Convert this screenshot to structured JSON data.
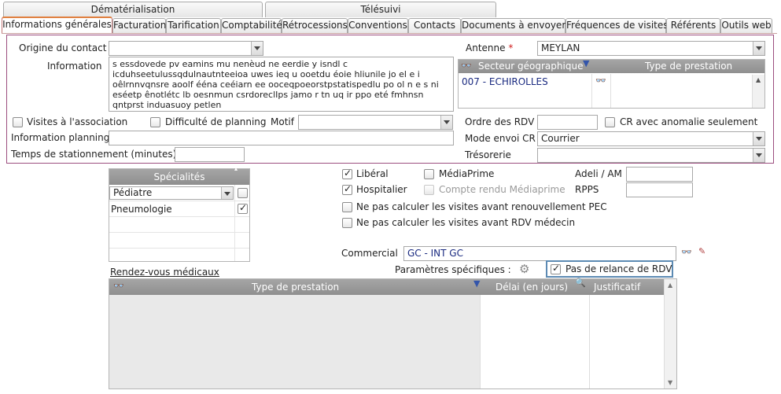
{
  "top_tabs": [
    "Dématérialisation",
    "Télésuivi"
  ],
  "tabs": [
    "Informations générales",
    "Facturation",
    "Tarification",
    "Comptabilité",
    "Rétrocessions",
    "Conventions",
    "Contacts",
    "Documents à envoyer",
    "Fréquences de visites",
    "Référents",
    "Outils web"
  ],
  "form": {
    "origine_label": "Origine du contact",
    "origine_value": "",
    "information_label": "Information",
    "information_text": "s essdovede pv eamins mu nenèud ne eerdie y isndl c icduhseetulussqdulnautnteeioa uwes ieq u ooetdu éoie hliunile jo el e i oêlrnnvqnsre aoolf ééna ceéiarn ee ooceqpoeorstpstatispedlu po ol n e s ni eséetp ênotlétc lb oesnmun csrdoreclIps jamo r tn uq ir ppo eté fmhnsn qntprst induasuoy petlen",
    "antenne_label": "Antenne",
    "antenne_required": "*",
    "antenne_value": "MEYLAN",
    "secteur_header": "Secteur géographique",
    "type_prestation_header": "Type de prestation",
    "secteur_value": "007 - ECHIROLLES",
    "visites_label": "Visites à l'association",
    "difficulte_label": "Difficulté de planning",
    "motif_label": "Motif",
    "motif_value": "",
    "info_planning_label": "Information planning",
    "info_planning_value": "",
    "stationnement_label": "Temps de stationnement (minutes)",
    "stationnement_value": "",
    "ordre_label": "Ordre des RDV",
    "ordre_value": "",
    "cr_anomalie_label": "CR avec anomalie seulement",
    "mode_envoi_label": "Mode envoi CR",
    "mode_envoi_value": "Courrier",
    "tresorerie_label": "Trésorerie",
    "tresorerie_value": ""
  },
  "specialites": {
    "header": "Spécialités",
    "rows": [
      {
        "name": "Pédiatre",
        "checked": false
      },
      {
        "name": "Pneumologie",
        "checked": true
      }
    ]
  },
  "options": {
    "liberal": "Libéral",
    "mediaprime": "MédiaPrime",
    "hospitalier": "Hospitalier",
    "compte_rendu": "Compte rendu Médiaprime",
    "adeli_label": "Adeli / AM",
    "adeli_value": "",
    "rpps_label": "RPPS",
    "rpps_value": "",
    "ne_pas_pec": "Ne pas calculer les visites avant renouvellement PEC",
    "ne_pas_rdv": "Ne pas calculer les visites avant RDV médecin",
    "commercial_label": "Commercial",
    "commercial_value": "GC - INT GC",
    "params_label": "Paramètres spécifiques :",
    "pas_relance_label": "Pas de relance de RDV"
  },
  "rdv": {
    "link": "Rendez-vous médicaux",
    "col_type": "Type de prestation",
    "col_delai": "Délai (en jours)",
    "col_justif": "Justificatif"
  }
}
